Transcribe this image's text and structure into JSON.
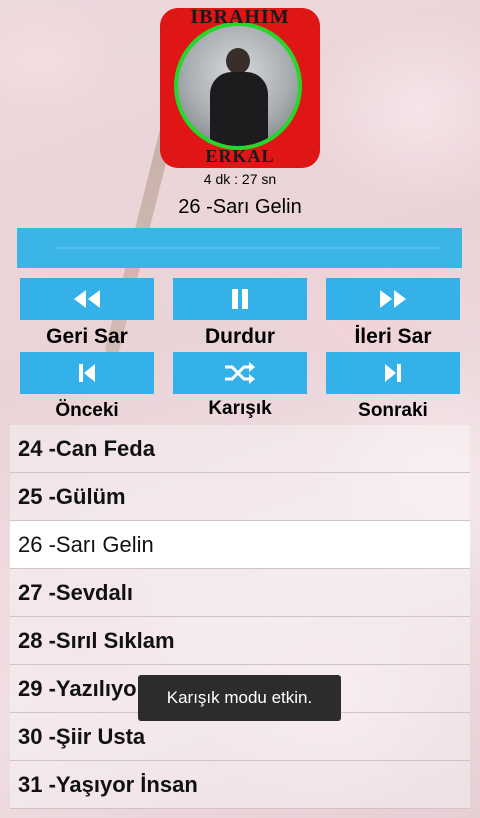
{
  "album": {
    "top_text": "İBRAHİM",
    "bottom_text": "ERKAL"
  },
  "player": {
    "duration": "4 dk : 27 sn",
    "now_playing": "26 -Sarı Gelin"
  },
  "controls": {
    "rewind": {
      "label": "Geri Sar",
      "icon": "rewind-icon"
    },
    "pause": {
      "label": "Durdur",
      "icon": "pause-icon"
    },
    "forward": {
      "label": "İleri Sar",
      "icon": "fast-forward-icon"
    },
    "previous": {
      "label": "Önceki",
      "icon": "skip-previous-icon"
    },
    "shuffle": {
      "label": "Karışık",
      "icon": "shuffle-icon"
    },
    "next": {
      "label": "Sonraki",
      "icon": "skip-next-icon"
    }
  },
  "colors": {
    "accent": "#34b1e8",
    "album_red": "#e01515",
    "album_ring": "#27d62a"
  },
  "playlist": [
    "24 -Can Feda",
    "25 -Gülüm",
    "26 -Sarı Gelin",
    "27 -Sevdalı",
    "28 -Sırıl Sıklam",
    "29 -Yazılıyor",
    "30 -Şiir Usta",
    "31 -Yaşıyor İnsan"
  ],
  "selected_index": 2,
  "toast": "Karışık modu etkin."
}
